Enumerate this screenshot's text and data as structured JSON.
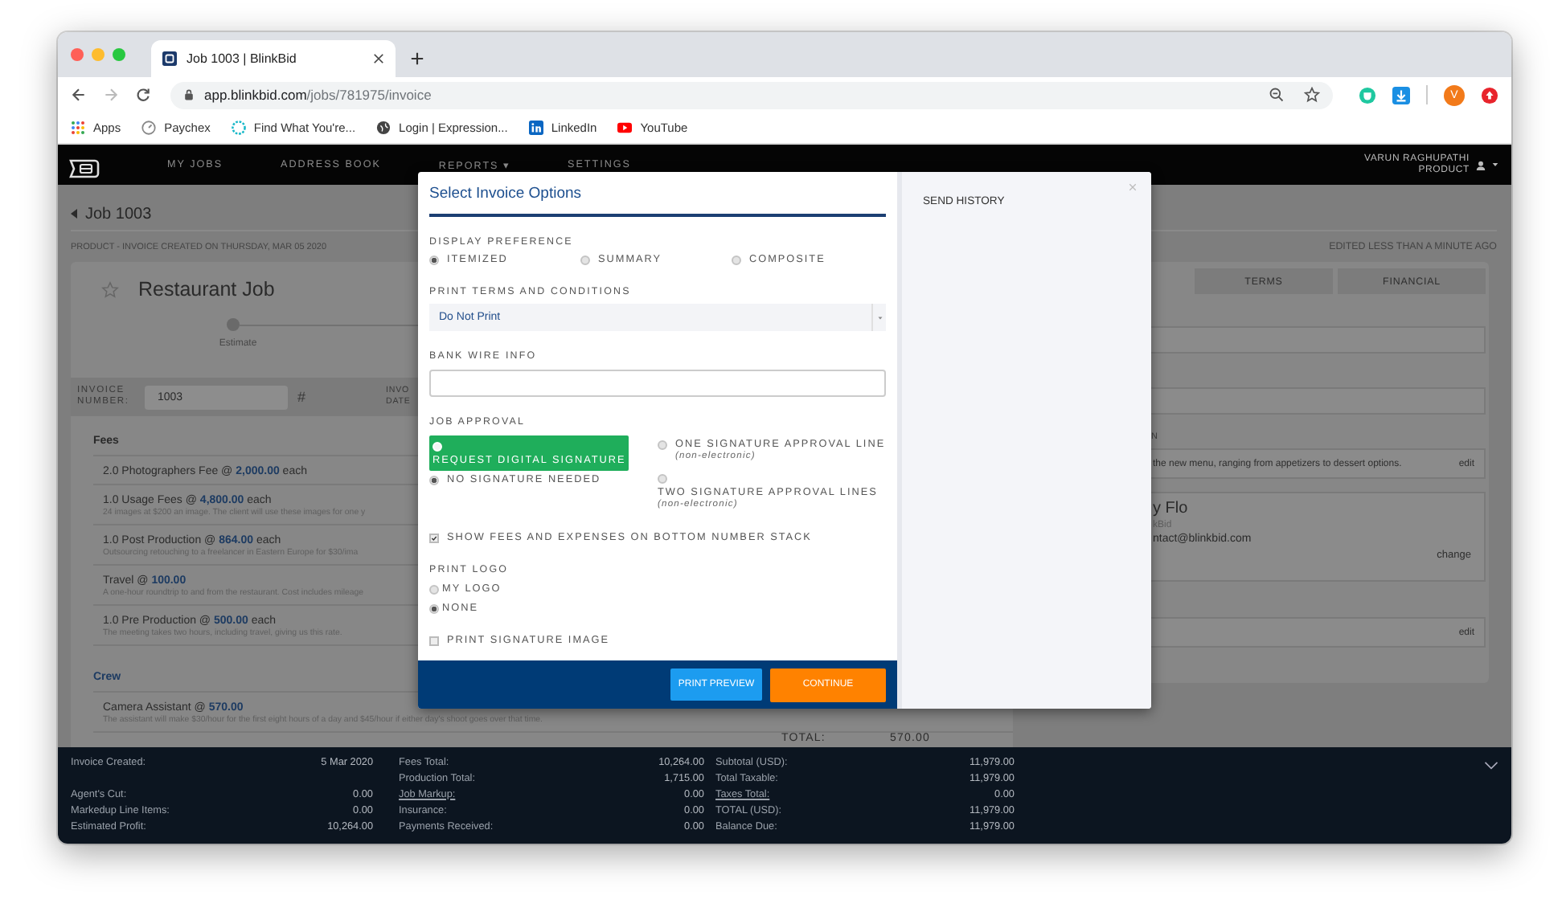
{
  "browser": {
    "tab_title": "Job 1003 | BlinkBid",
    "url_host": "app.blinkbid.com",
    "url_path": "/jobs/781975/invoice",
    "profile_initial": "V",
    "bookmarks": [
      {
        "label": "Apps",
        "kind": "apps"
      },
      {
        "label": "Paychex",
        "kind": "paychex"
      },
      {
        "label": "Find What You're...",
        "kind": "find"
      },
      {
        "label": "Login | Expression...",
        "kind": "globe"
      },
      {
        "label": "LinkedIn",
        "kind": "linkedin"
      },
      {
        "label": "YouTube",
        "kind": "youtube"
      }
    ]
  },
  "nav": {
    "items": [
      "MY JOBS",
      "ADDRESS BOOK",
      "REPORTS ▾",
      "SETTINGS"
    ],
    "user_name": "VARUN RAGHUPATHI",
    "user_role": "PRODUCT"
  },
  "job": {
    "back_label": "Job 1003",
    "subtitle": "PRODUCT - INVOICE CREATED ON THURSDAY, MAR 05 2020",
    "edited": "EDITED LESS THAN A MINUTE AGO",
    "title": "Restaurant Job",
    "starred": false,
    "stage": "Estimate",
    "invoice_number_label": "INVOICE NUMBER:",
    "invoice_number": "1003",
    "hash": "#",
    "date_label": "INVO DATE",
    "sections": [
      {
        "title": "Fees",
        "items": [
          {
            "line": "2.0 Photographers Fee @ **2,000.00** each"
          },
          {
            "line": "1.0 Usage Fees @ **4,800.00** each",
            "description": "24 images at $200 an image. The client will use these images for one y"
          },
          {
            "line": "1.0 Post Production @ **864.00** each",
            "description": "Outsourcing retouching to a freelancer in Eastern Europe for $30/ima"
          },
          {
            "line": "Travel @ **100.00**",
            "description": "A one-hour roundtrip to and from the restaurant. Cost includes mileage"
          },
          {
            "line": "1.0 Pre Production @ **500.00** each",
            "description": "The meeting takes two hours, including travel, giving us this rate."
          }
        ]
      },
      {
        "title": "Crew",
        "items": [
          {
            "line": "Camera Assistant @ **570.00**",
            "description": "The assistant will make $30/hour for the first eight hours of a day and $45/hour if either day's shoot goes over that time."
          }
        ]
      }
    ],
    "total_label": "TOTAL:",
    "total_value": "570.00"
  },
  "side": {
    "tabs": [
      {
        "label": "TERMS",
        "selected": false
      },
      {
        "label": "FINANCIAL",
        "selected": false
      }
    ],
    "section_label": "N",
    "description": "the new menu, ranging from appetizers to dessert options.",
    "edit": "edit",
    "contact_name": "y Flo",
    "contact_company": "kBid",
    "contact_email": "ntact@blinkbid.com",
    "contact_action": "change",
    "second_edit": "edit"
  },
  "modal": {
    "title": "Select Invoice Options",
    "history_title": "SEND HISTORY",
    "display_preference": {
      "label": "DISPLAY PREFERENCE",
      "options": [
        {
          "label": "ITEMIZED",
          "selected": true
        },
        {
          "label": "SUMMARY",
          "selected": false
        },
        {
          "label": "COMPOSITE",
          "selected": false
        }
      ]
    },
    "terms": {
      "label": "PRINT TERMS AND CONDITIONS",
      "value": "Do Not Print"
    },
    "bank_wire": {
      "label": "BANK WIRE INFO"
    },
    "job_approval": {
      "label": "JOB APPROVAL",
      "options": [
        {
          "label": "REQUEST DIGITAL SIGNATURE",
          "kind": "stacked",
          "selected": false,
          "highlighted": true
        },
        {
          "label": "NO SIGNATURE NEEDED",
          "kind": "inline",
          "selected": true,
          "highlighted": false
        },
        {
          "label": "ONE SIGNATURE APPROVAL LINE",
          "note": "(non-electronic)",
          "kind": "inline",
          "selected": false,
          "highlighted": false
        },
        {
          "label": "TWO SIGNATURE APPROVAL LINES",
          "note": "(non-electronic)",
          "kind": "stacked",
          "selected": false,
          "highlighted": false
        }
      ]
    },
    "show_fees": {
      "label": "SHOW FEES AND EXPENSES ON BOTTOM NUMBER STACK",
      "checked": true
    },
    "print_logo": {
      "label": "PRINT LOGO",
      "options": [
        {
          "label": "MY LOGO",
          "selected": false
        },
        {
          "label": "NONE",
          "selected": true
        }
      ]
    },
    "print_signature": {
      "label": "PRINT SIGNATURE IMAGE",
      "checked": false
    },
    "buttons": [
      {
        "label": "PRINT PREVIEW",
        "kind": "secondary"
      },
      {
        "label": "CONTINUE",
        "kind": "primary"
      }
    ]
  },
  "footer": {
    "columns": [
      {
        "rows": [
          {
            "label": "Invoice Created:",
            "value": "5 Mar 2020",
            "link": false
          },
          {
            "label": "Agent's Cut:",
            "value": "0.00",
            "link": false
          },
          {
            "label": "Markedup Line Items:",
            "value": "0.00",
            "link": false
          },
          {
            "label": "Estimated Profit:",
            "value": "10,264.00",
            "link": false
          }
        ]
      },
      {
        "rows": [
          {
            "label": "Fees Total:",
            "value": "10,264.00",
            "link": false
          },
          {
            "label": "Production Total:",
            "value": "1,715.00",
            "link": false
          },
          {
            "label": "Job Markup:",
            "value": "0.00",
            "link": true
          },
          {
            "label": "Insurance:",
            "value": "0.00",
            "link": false
          },
          {
            "label": "Payments Received:",
            "value": "0.00",
            "link": false
          }
        ]
      },
      {
        "rows": [
          {
            "label": "Subtotal (USD):",
            "value": "11,979.00",
            "link": false
          },
          {
            "label": "Total Taxable:",
            "value": "11,979.00",
            "link": false
          },
          {
            "label": "Taxes Total:",
            "value": "0.00",
            "link": true
          },
          {
            "label": "TOTAL (USD):",
            "value": "11,979.00",
            "link": false
          },
          {
            "label": "Balance Due:",
            "value": "11,979.00",
            "link": false
          }
        ]
      }
    ]
  }
}
